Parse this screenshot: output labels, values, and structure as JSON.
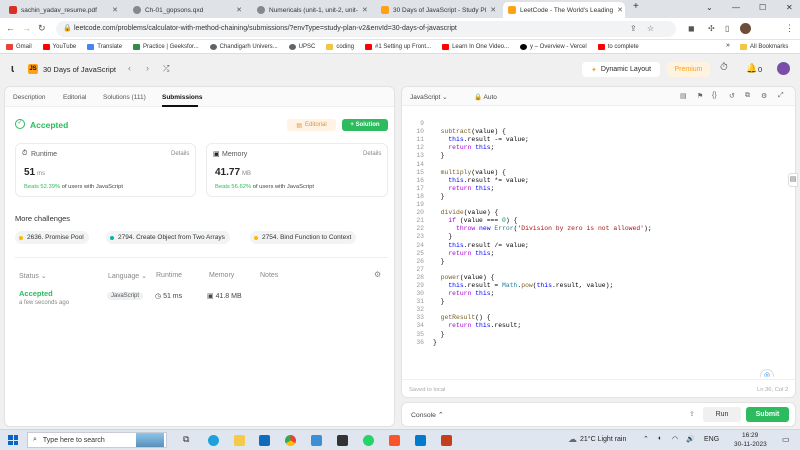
{
  "browser": {
    "tabs": [
      {
        "title": "sachin_yadav_resume.pdf",
        "color": "#d93025"
      },
      {
        "title": "Ch-01_gopsons.qxd",
        "color": "#5f6368"
      },
      {
        "title": "Numericals (unit-1, unit-2, unit-",
        "color": "#5f6368"
      },
      {
        "title": "30 Days of JavaScript - Study Pl",
        "color": "#ffa116"
      },
      {
        "title": "LeetCode - The World's Leading",
        "color": "#ffa116"
      }
    ],
    "url": "leetcode.com/problems/calculator-with-method-chaining/submissions/?envType=study-plan-v2&envId=30-days-of-javascript",
    "bookmarks": [
      {
        "label": "Gmail",
        "color": "#ea4335"
      },
      {
        "label": "YouTube",
        "color": "#ff0000"
      },
      {
        "label": "Translate",
        "color": "#4285f4"
      },
      {
        "label": "Practice | Geeksfor...",
        "color": "#2f8d46"
      },
      {
        "label": "Chandigarh Univers...",
        "color": "#5f6368"
      },
      {
        "label": "UPSC",
        "color": "#5f6368"
      },
      {
        "label": "coding",
        "color": "#f4c542"
      },
      {
        "label": "#1 Setting up Front...",
        "color": "#ff0000"
      },
      {
        "label": "Learn In One Video...",
        "color": "#ff0000"
      },
      {
        "label": "y – Overview - Vercel",
        "color": "#000000"
      },
      {
        "label": "to complete",
        "color": "#ff0000"
      }
    ],
    "all_bookmarks": "All Bookmarks"
  },
  "lc_nav": {
    "study_plan": "30 Days of JavaScript",
    "dynamic_layout": "Dynamic Layout",
    "premium": "Premium",
    "coins": "0"
  },
  "left": {
    "tabs": [
      "Description",
      "Editorial",
      "Solutions (111)",
      "Submissions"
    ],
    "status": "Accepted",
    "editorial_btn": "Editorial",
    "solution_btn": "+ Solution",
    "runtime": {
      "title": "Runtime",
      "details": "Details",
      "value": "51",
      "unit": "ms",
      "beats_pct": "Beats 52.39%",
      "beats_rest": "of users with JavaScript"
    },
    "memory": {
      "title": "Memory",
      "details": "Details",
      "value": "41.77",
      "unit": "MB",
      "beats_pct": "Beats 56.62%",
      "beats_rest": "of users with JavaScript"
    },
    "more_title": "More challenges",
    "challenges": [
      "2636. Promise Pool",
      "2794. Create Object from Two Arrays",
      "2754. Bind Function to Context"
    ],
    "table_headers": {
      "status": "Status",
      "language": "Language",
      "runtime": "Runtime",
      "memory": "Memory",
      "notes": "Notes"
    },
    "row": {
      "status": "Accepted",
      "time": "a few seconds ago",
      "language": "JavaScript",
      "runtime": "51 ms",
      "memory": "41.8 MB"
    }
  },
  "editor": {
    "language": "JavaScript",
    "mode": "Auto",
    "saved": "Saved to local",
    "position": "Ln 36, Col 2",
    "line_numbers": [
      "9",
      "10",
      "11",
      "12",
      "13",
      "14",
      "15",
      "16",
      "17",
      "18",
      "19",
      "20",
      "21",
      "22",
      "23",
      "24",
      "25",
      "26",
      "27",
      "28",
      "29",
      "30",
      "31",
      "32",
      "33",
      "34",
      "35",
      "36"
    ]
  },
  "console": {
    "label": "Console",
    "run": "Run",
    "submit": "Submit"
  },
  "taskbar": {
    "search": "Type here to search",
    "weather": "21°C  Light rain",
    "lang": "ENG",
    "time": "16:29",
    "date": "30-11-2023"
  },
  "colors": {
    "accepted": "#2cbb5d",
    "brand_orange": "#ffa116"
  }
}
